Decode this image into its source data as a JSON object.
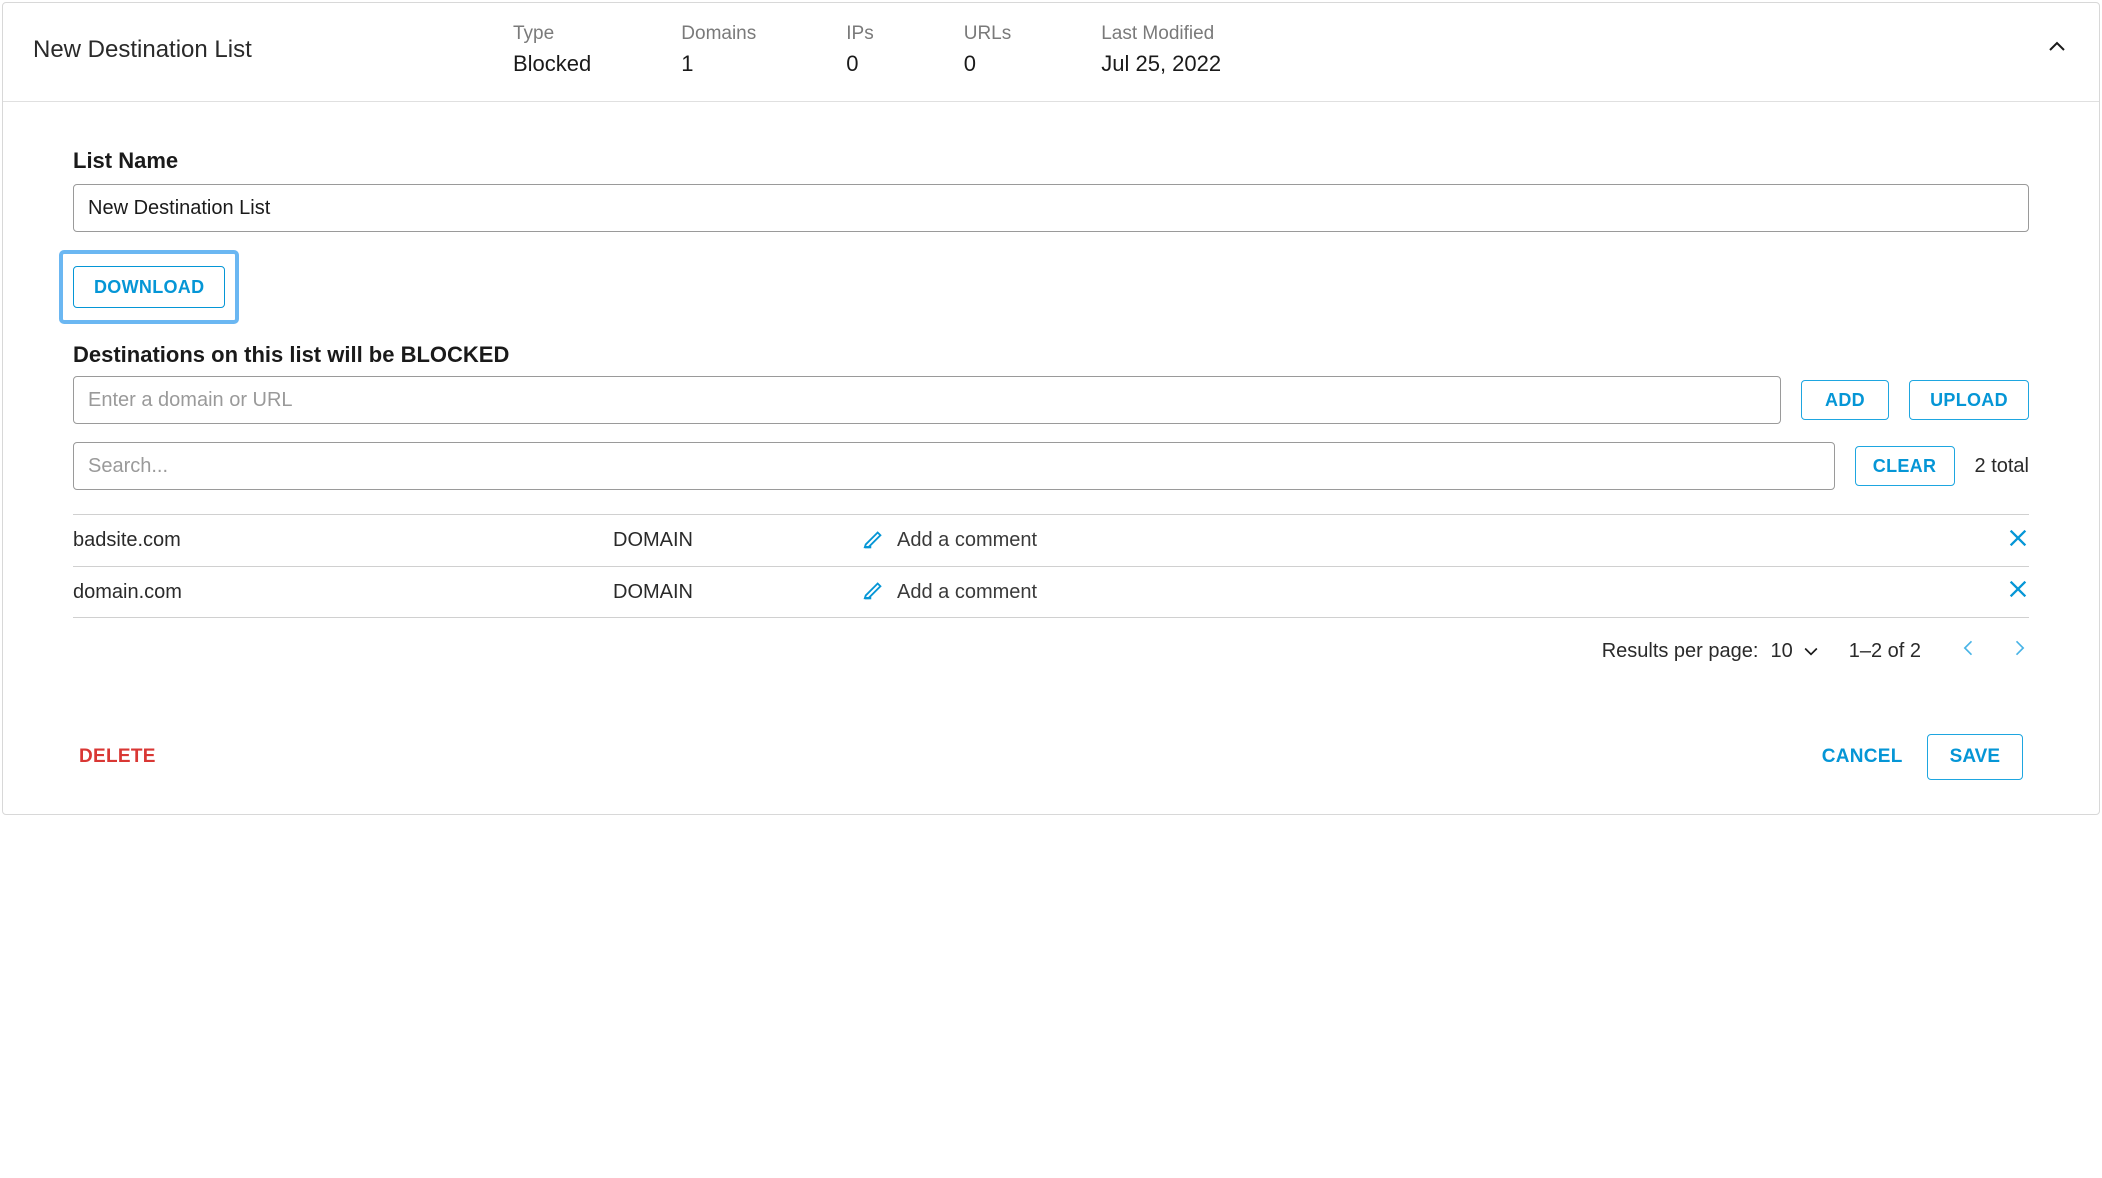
{
  "header": {
    "title": "New Destination List",
    "stats": {
      "type_label": "Type",
      "type_value": "Blocked",
      "domains_label": "Domains",
      "domains_value": "1",
      "ips_label": "IPs",
      "ips_value": "0",
      "urls_label": "URLs",
      "urls_value": "0",
      "modified_label": "Last Modified",
      "modified_value": "Jul 25, 2022"
    }
  },
  "form": {
    "list_name_label": "List Name",
    "list_name_value": "New Destination List",
    "download_label": "DOWNLOAD",
    "destinations_heading": "Destinations on this list will be BLOCKED",
    "domain_placeholder": "Enter a domain or URL",
    "add_label": "ADD",
    "upload_label": "UPLOAD",
    "search_placeholder": "Search...",
    "clear_label": "CLEAR",
    "total_text": "2 total"
  },
  "rows": [
    {
      "destination": "badsite.com",
      "type": "DOMAIN",
      "comment_placeholder": "Add a comment"
    },
    {
      "destination": "domain.com",
      "type": "DOMAIN",
      "comment_placeholder": "Add a comment"
    }
  ],
  "pagination": {
    "per_page_label": "Results per page:",
    "per_page_value": "10",
    "range_text": "1–2 of 2"
  },
  "footer": {
    "delete_label": "DELETE",
    "cancel_label": "CANCEL",
    "save_label": "SAVE"
  }
}
